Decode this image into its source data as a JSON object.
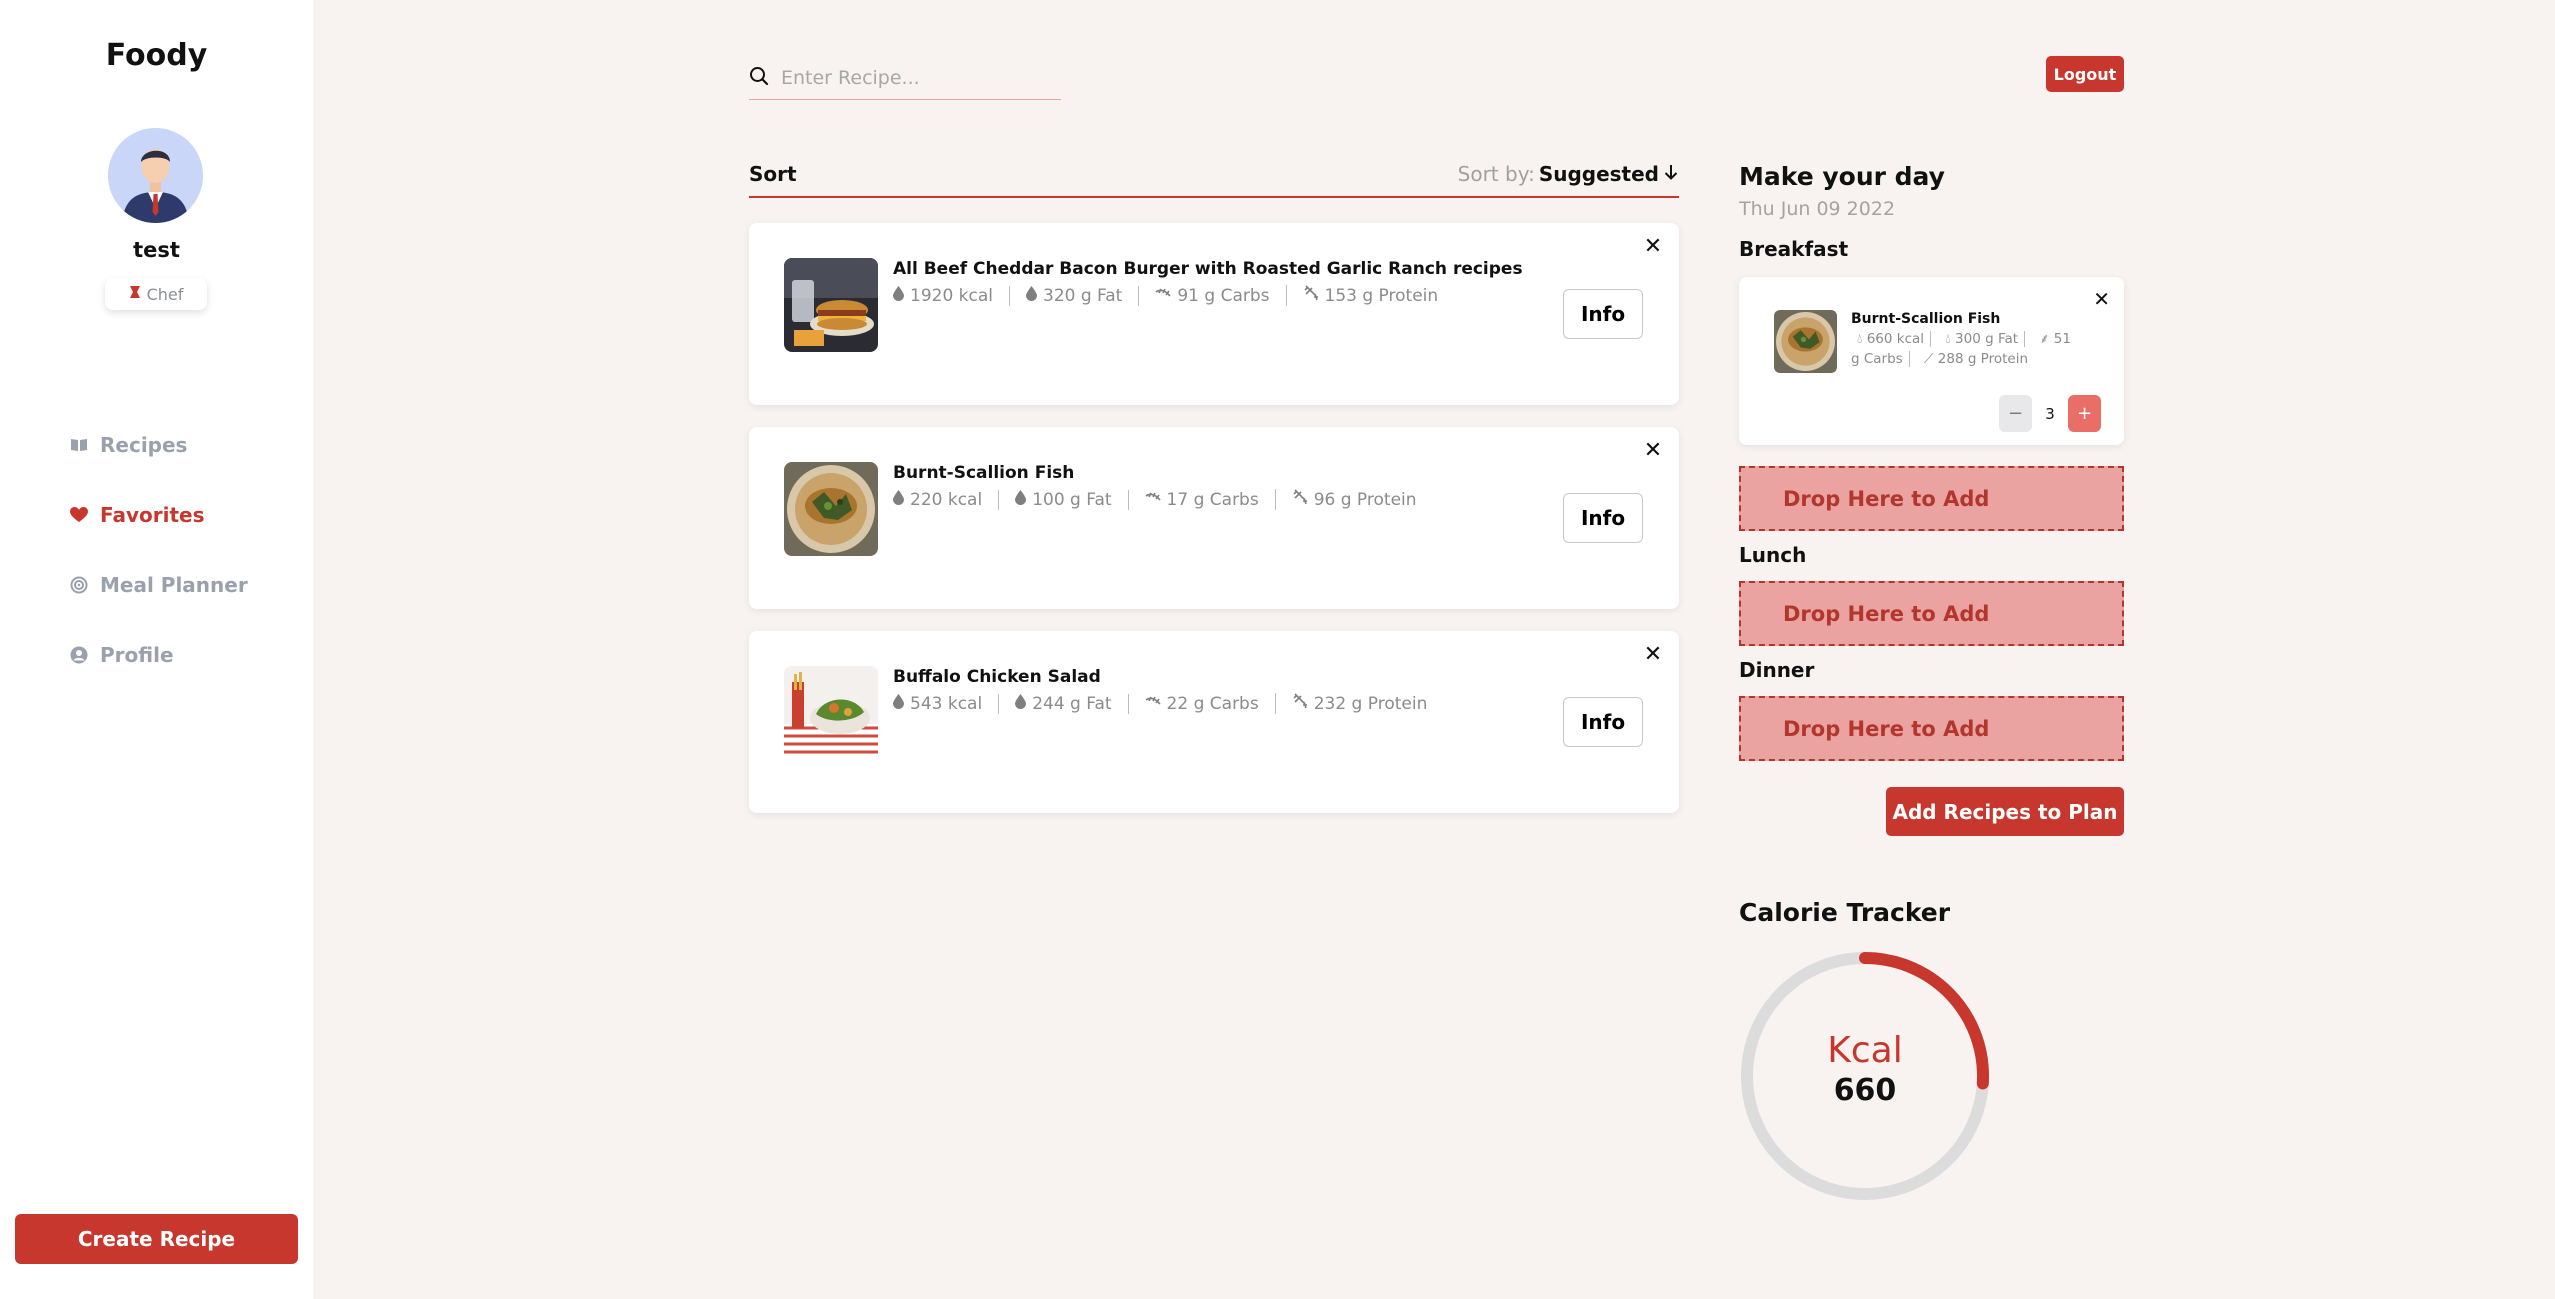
{
  "app": {
    "brand": "Foody"
  },
  "user": {
    "name": "test",
    "role": "Chef"
  },
  "nav": {
    "items": [
      {
        "label": "Recipes",
        "icon": "book-icon",
        "active": false
      },
      {
        "label": "Favorites",
        "icon": "heart-icon",
        "active": true
      },
      {
        "label": "Meal Planner",
        "icon": "target-icon",
        "active": false
      },
      {
        "label": "Profile",
        "icon": "user-circle-icon",
        "active": false
      }
    ]
  },
  "create_recipe_label": "Create Recipe",
  "search": {
    "placeholder": "Enter Recipe...",
    "value": ""
  },
  "logout_label": "Logout",
  "sort": {
    "label": "Sort",
    "sort_by_label": "Sort by:",
    "sort_by_value": "Suggested"
  },
  "recipes": [
    {
      "title": "All Beef Cheddar Bacon Burger with Roasted Garlic Ranch recipes",
      "kcal": "1920 kcal",
      "fat": "320 g Fat",
      "carbs": "91 g Carbs",
      "protein": "153 g Protein",
      "info_label": "Info"
    },
    {
      "title": "Burnt-Scallion Fish",
      "kcal": "220 kcal",
      "fat": "100 g Fat",
      "carbs": "17 g Carbs",
      "protein": "96 g Protein",
      "info_label": "Info"
    },
    {
      "title": "Buffalo Chicken Salad",
      "kcal": "543 kcal",
      "fat": "244 g Fat",
      "carbs": "22 g Carbs",
      "protein": "232 g Protein",
      "info_label": "Info"
    }
  ],
  "planner": {
    "title": "Make your day",
    "date": "Thu Jun 09 2022",
    "breakfast_label": "Breakfast",
    "lunch_label": "Lunch",
    "dinner_label": "Dinner",
    "breakfast_item": {
      "title": "Burnt-Scallion Fish",
      "kcal": "660 kcal",
      "fat": "300 g Fat",
      "carbs": "51 g Carbs",
      "protein": "288 g Protein",
      "quantity": "3"
    },
    "dropzone_label": "Drop Here to Add",
    "add_button_label": "Add Recipes to Plan"
  },
  "tracker": {
    "title": "Calorie Tracker",
    "label": "Kcal",
    "value": "660",
    "progress": 0.26
  },
  "colors": {
    "accent": "#c8372d",
    "background": "#f8f3f0",
    "dropzone": "#eaa3a0"
  }
}
